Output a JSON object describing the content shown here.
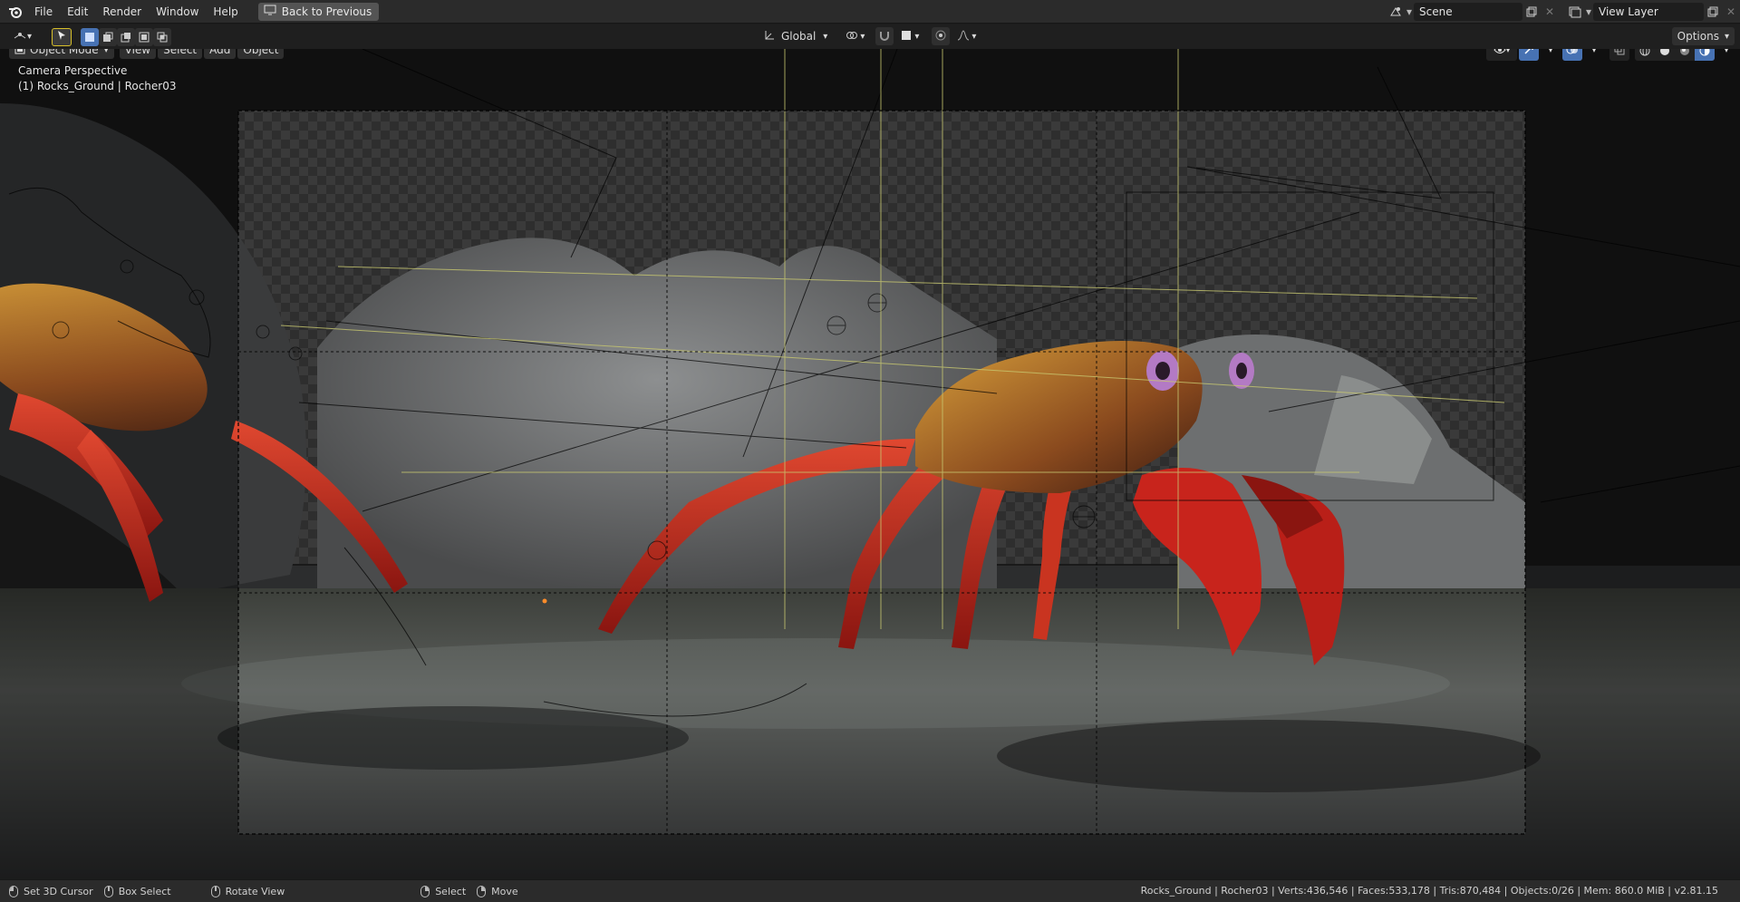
{
  "topbar": {
    "menus": [
      "File",
      "Edit",
      "Render",
      "Window",
      "Help"
    ],
    "back_label": "Back to Previous",
    "scene_label": "Scene",
    "view_layer_label": "View Layer"
  },
  "header": {
    "mode_label": "Object Mode",
    "menus": [
      "View",
      "Select",
      "Add",
      "Object"
    ],
    "orientation_label": "Global",
    "options_label": "Options"
  },
  "viewport": {
    "view_name": "Camera Perspective",
    "object_info": "(1) Rocks_Ground | Rocher03"
  },
  "statusbar": {
    "items": [
      "Set 3D Cursor",
      "Box Select",
      "Rotate View",
      "Select",
      "Move"
    ],
    "stats": "Rocks_Ground | Rocher03 | Verts:436,546 | Faces:533,178 | Tris:870,484 | Objects:0/26 | Mem: 860.0 MiB | v2.81.15"
  },
  "icons": {
    "logo": "blender-logo-icon",
    "accent": "#4772b3",
    "overlay_line": "#b8b86a"
  }
}
